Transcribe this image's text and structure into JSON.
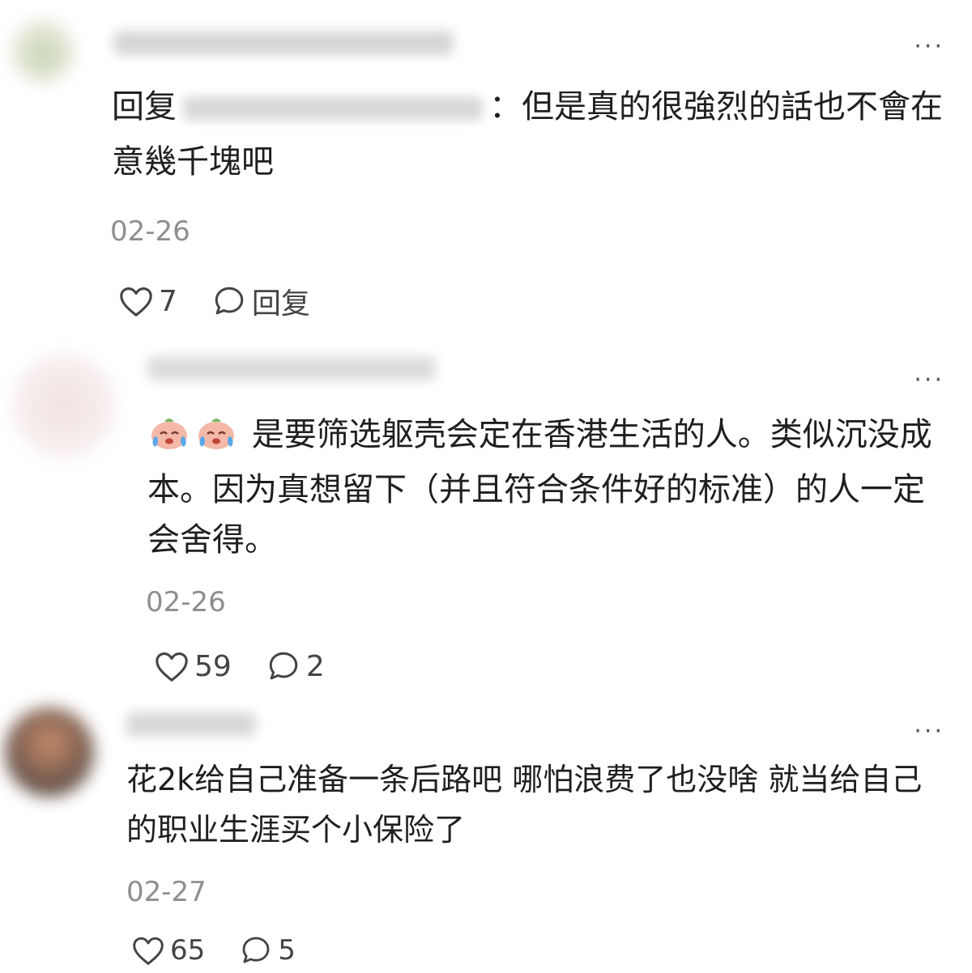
{
  "comments": [
    {
      "more": "···",
      "reply_prefix": "回复",
      "text": "：但是真的很強烈的話也不會在意幾千塊吧",
      "date": "02-26",
      "likes": "7",
      "reply_label": "回复"
    },
    {
      "more": "···",
      "text": "是要筛选躯壳会定在香港生活的人。类似沉没成本。因为真想留下（并且符合条件好的标准）的人一定会舍得。",
      "date": "02-26",
      "likes": "59",
      "replies": "2"
    },
    {
      "more": "···",
      "text": "花2k给自己准备一条后路吧 哪怕浪费了也没啥 就当给自己的职业生涯买个小保险了",
      "date": "02-27",
      "likes": "65",
      "replies": "5"
    }
  ],
  "icons": {
    "like": "heart-outline-icon",
    "comment": "speech-bubble-icon",
    "emoji": "crying-face-emoji"
  },
  "colors": {
    "text": "#1f1f1f",
    "muted": "#8e8e8e",
    "icon": "#444444"
  }
}
